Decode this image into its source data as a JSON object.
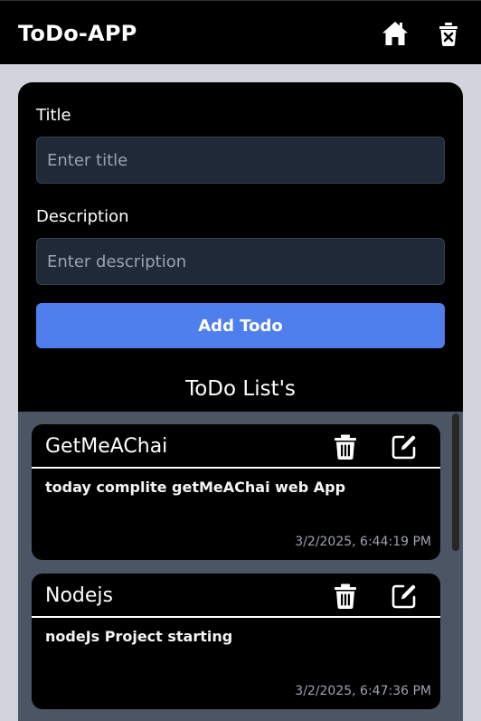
{
  "navbar": {
    "brand": "ToDo-APP",
    "home_icon": "home-icon",
    "delete_icon": "delete-box-icon"
  },
  "form": {
    "title_label": "Title",
    "title_placeholder": "Enter title",
    "title_value": "",
    "description_label": "Description",
    "description_placeholder": "Enter description",
    "description_value": "",
    "add_button": "Add Todo"
  },
  "list": {
    "heading": "ToDo List's",
    "todos": [
      {
        "title": "GetMeAChai",
        "description": "today complite getMeAChai web App",
        "timestamp": "3/2/2025, 6:44:19 PM"
      },
      {
        "title": "Nodejs",
        "description": "nodeJs Project starting",
        "timestamp": "3/2/2025, 6:47:36 PM"
      }
    ]
  },
  "colors": {
    "accent": "#4f7fec",
    "background": "#d1d5db",
    "card": "#000000",
    "list_area": "#4b5563",
    "input_bg": "#1f2937"
  }
}
